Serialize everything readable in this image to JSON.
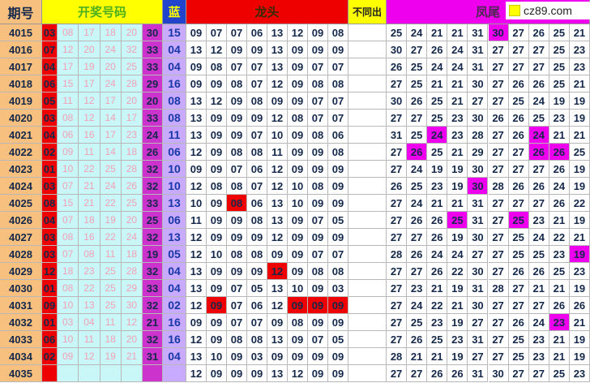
{
  "colors": {
    "issue": "#f8c07e",
    "red": "#ee0000",
    "cyan": "#c9f7f8",
    "magenta": "#cc33cc",
    "blue": "#c8aaff",
    "hit_fw": "#ee00ee",
    "header_yellow": "#ffff00"
  },
  "header": {
    "issue": "期号",
    "kjhm": "开奖号码",
    "blue": "蓝",
    "longtou": "龙头",
    "butongchu": "不同出",
    "fengwei": "凤尾",
    "site": "cz89.com"
  },
  "rows": [
    {
      "issue": "4015",
      "r": [
        "03",
        "08",
        "17",
        "18",
        "20"
      ],
      "sum": "30",
      "blue": "15",
      "lt": [
        "09",
        "07",
        "07",
        "06",
        "13",
        "12",
        "09",
        "08"
      ],
      "fw": [
        "25",
        "24",
        "21",
        "21",
        "31",
        "30",
        "27",
        "26",
        "25",
        "21"
      ],
      "lth": [],
      "fwh": [
        5
      ]
    },
    {
      "issue": "4016",
      "r": [
        "07",
        "12",
        "20",
        "24",
        "32"
      ],
      "sum": "33",
      "blue": "04",
      "lt": [
        "13",
        "12",
        "09",
        "09",
        "13",
        "09",
        "09",
        "09"
      ],
      "fw": [
        "30",
        "27",
        "26",
        "24",
        "31",
        "27",
        "27",
        "27",
        "25",
        "23"
      ],
      "lth": [],
      "fwh": []
    },
    {
      "issue": "4017",
      "r": [
        "04",
        "17",
        "19",
        "20",
        "25"
      ],
      "sum": "33",
      "blue": "04",
      "lt": [
        "09",
        "08",
        "07",
        "07",
        "13",
        "09",
        "07",
        "07"
      ],
      "fw": [
        "26",
        "25",
        "24",
        "24",
        "31",
        "27",
        "27",
        "27",
        "25",
        "23"
      ],
      "lth": [],
      "fwh": []
    },
    {
      "issue": "4018",
      "r": [
        "06",
        "15",
        "17",
        "24",
        "28"
      ],
      "sum": "29",
      "blue": "16",
      "lt": [
        "09",
        "09",
        "08",
        "07",
        "12",
        "09",
        "08",
        "08"
      ],
      "fw": [
        "27",
        "25",
        "21",
        "21",
        "30",
        "27",
        "26",
        "26",
        "25",
        "21"
      ],
      "lth": [],
      "fwh": []
    },
    {
      "issue": "4019",
      "r": [
        "05",
        "11",
        "12",
        "17",
        "20"
      ],
      "sum": "20",
      "blue": "08",
      "lt": [
        "13",
        "12",
        "09",
        "08",
        "09",
        "09",
        "07",
        "07"
      ],
      "fw": [
        "30",
        "26",
        "25",
        "21",
        "27",
        "27",
        "25",
        "24",
        "19",
        "19"
      ],
      "lth": [],
      "fwh": []
    },
    {
      "issue": "4020",
      "r": [
        "03",
        "08",
        "12",
        "14",
        "17"
      ],
      "sum": "33",
      "blue": "08",
      "lt": [
        "13",
        "09",
        "09",
        "09",
        "12",
        "08",
        "07",
        "07"
      ],
      "fw": [
        "27",
        "27",
        "25",
        "23",
        "30",
        "26",
        "26",
        "25",
        "23",
        "19"
      ],
      "lth": [],
      "fwh": []
    },
    {
      "issue": "4021",
      "r": [
        "04",
        "06",
        "16",
        "17",
        "23"
      ],
      "sum": "24",
      "blue": "11",
      "lt": [
        "13",
        "09",
        "09",
        "07",
        "10",
        "09",
        "08",
        "06"
      ],
      "fw": [
        "31",
        "25",
        "24",
        "23",
        "28",
        "27",
        "26",
        "24",
        "21",
        "21"
      ],
      "lth": [],
      "fwh": [
        2,
        7
      ]
    },
    {
      "issue": "4022",
      "r": [
        "02",
        "09",
        "11",
        "14",
        "18"
      ],
      "sum": "26",
      "blue": "06",
      "lt": [
        "12",
        "09",
        "08",
        "08",
        "11",
        "09",
        "09",
        "08"
      ],
      "fw": [
        "27",
        "26",
        "25",
        "21",
        "29",
        "27",
        "27",
        "26",
        "26",
        "25"
      ],
      "lth": [],
      "fwh": [
        1,
        7,
        8
      ]
    },
    {
      "issue": "4023",
      "r": [
        "01",
        "10",
        "22",
        "25",
        "28"
      ],
      "sum": "32",
      "blue": "10",
      "lt": [
        "09",
        "09",
        "07",
        "06",
        "12",
        "09",
        "09",
        "09"
      ],
      "fw": [
        "27",
        "24",
        "19",
        "19",
        "30",
        "27",
        "27",
        "27",
        "26",
        "19"
      ],
      "lth": [],
      "fwh": []
    },
    {
      "issue": "4024",
      "r": [
        "03",
        "07",
        "21",
        "24",
        "26"
      ],
      "sum": "32",
      "blue": "10",
      "lt": [
        "12",
        "08",
        "08",
        "07",
        "12",
        "10",
        "08",
        "09"
      ],
      "fw": [
        "26",
        "25",
        "23",
        "19",
        "30",
        "28",
        "26",
        "26",
        "24",
        "19"
      ],
      "lth": [],
      "fwh": [
        4
      ]
    },
    {
      "issue": "4025",
      "r": [
        "08",
        "15",
        "21",
        "22",
        "25"
      ],
      "sum": "33",
      "blue": "13",
      "lt": [
        "10",
        "09",
        "08",
        "06",
        "13",
        "10",
        "09",
        "09"
      ],
      "fw": [
        "27",
        "24",
        "21",
        "21",
        "31",
        "27",
        "27",
        "27",
        "26",
        "22"
      ],
      "lth": [
        2
      ],
      "fwh": []
    },
    {
      "issue": "4026",
      "r": [
        "04",
        "07",
        "18",
        "19",
        "20"
      ],
      "sum": "25",
      "blue": "06",
      "lt": [
        "11",
        "09",
        "09",
        "08",
        "13",
        "09",
        "07",
        "05"
      ],
      "fw": [
        "27",
        "26",
        "26",
        "25",
        "31",
        "27",
        "25",
        "23",
        "21",
        "19"
      ],
      "lth": [],
      "fwh": [
        3,
        6
      ]
    },
    {
      "issue": "4027",
      "r": [
        "03",
        "08",
        "16",
        "22",
        "24"
      ],
      "sum": "32",
      "blue": "13",
      "lt": [
        "12",
        "09",
        "09",
        "09",
        "12",
        "09",
        "09",
        "09"
      ],
      "fw": [
        "27",
        "27",
        "26",
        "19",
        "30",
        "27",
        "25",
        "24",
        "22",
        "21"
      ],
      "lth": [],
      "fwh": []
    },
    {
      "issue": "4028",
      "r": [
        "03",
        "07",
        "08",
        "11",
        "18"
      ],
      "sum": "19",
      "blue": "05",
      "lt": [
        "12",
        "10",
        "08",
        "08",
        "09",
        "09",
        "07",
        "07"
      ],
      "fw": [
        "28",
        "26",
        "24",
        "24",
        "27",
        "27",
        "25",
        "25",
        "23",
        "19"
      ],
      "lth": [],
      "fwh": [
        9
      ]
    },
    {
      "issue": "4029",
      "r": [
        "12",
        "18",
        "23",
        "25",
        "28"
      ],
      "sum": "32",
      "blue": "04",
      "lt": [
        "13",
        "09",
        "09",
        "09",
        "12",
        "09",
        "08",
        "08"
      ],
      "fw": [
        "27",
        "27",
        "26",
        "22",
        "30",
        "27",
        "26",
        "26",
        "25",
        "23"
      ],
      "lth": [
        4
      ],
      "fwh": []
    },
    {
      "issue": "4030",
      "r": [
        "01",
        "08",
        "22",
        "25",
        "29"
      ],
      "sum": "33",
      "blue": "04",
      "lt": [
        "13",
        "09",
        "07",
        "05",
        "13",
        "10",
        "09",
        "03"
      ],
      "fw": [
        "27",
        "23",
        "21",
        "19",
        "31",
        "28",
        "27",
        "21",
        "21",
        "19"
      ],
      "lth": [],
      "fwh": []
    },
    {
      "issue": "4031",
      "r": [
        "09",
        "10",
        "13",
        "25",
        "30"
      ],
      "sum": "32",
      "blue": "02",
      "lt": [
        "12",
        "09",
        "07",
        "06",
        "12",
        "09",
        "09",
        "09"
      ],
      "fw": [
        "27",
        "24",
        "22",
        "21",
        "30",
        "27",
        "27",
        "27",
        "26",
        "26"
      ],
      "lth": [
        1,
        5,
        6,
        7
      ],
      "fwh": []
    },
    {
      "issue": "4032",
      "r": [
        "01",
        "03",
        "04",
        "11",
        "12"
      ],
      "sum": "21",
      "blue": "16",
      "lt": [
        "09",
        "09",
        "07",
        "07",
        "09",
        "08",
        "09",
        "09"
      ],
      "fw": [
        "27",
        "25",
        "23",
        "19",
        "27",
        "27",
        "26",
        "24",
        "23",
        "21"
      ],
      "lth": [],
      "fwh": [
        8
      ]
    },
    {
      "issue": "4033",
      "r": [
        "06",
        "10",
        "11",
        "18",
        "20"
      ],
      "sum": "32",
      "blue": "16",
      "lt": [
        "12",
        "09",
        "08",
        "08",
        "13",
        "09",
        "07",
        "05"
      ],
      "fw": [
        "27",
        "26",
        "25",
        "23",
        "31",
        "27",
        "25",
        "23",
        "21",
        "19"
      ],
      "lth": [],
      "fwh": []
    },
    {
      "issue": "4034",
      "r": [
        "02",
        "09",
        "12",
        "19",
        "21"
      ],
      "sum": "31",
      "blue": "04",
      "lt": [
        "13",
        "10",
        "09",
        "03",
        "09",
        "09",
        "09",
        "09"
      ],
      "fw": [
        "28",
        "21",
        "21",
        "19",
        "27",
        "27",
        "25",
        "23",
        "21",
        "19"
      ],
      "lth": [],
      "fwh": []
    },
    {
      "issue": "4035",
      "r": [
        "",
        "",
        "",
        "",
        ""
      ],
      "sum": "",
      "blue": "",
      "lt": [
        "12",
        "09",
        "09",
        "09",
        "13",
        "12",
        "09",
        "09"
      ],
      "fw": [
        "27",
        "27",
        "26",
        "26",
        "31",
        "30",
        "27",
        "27",
        "25",
        "23"
      ],
      "lth": [],
      "fwh": []
    }
  ]
}
